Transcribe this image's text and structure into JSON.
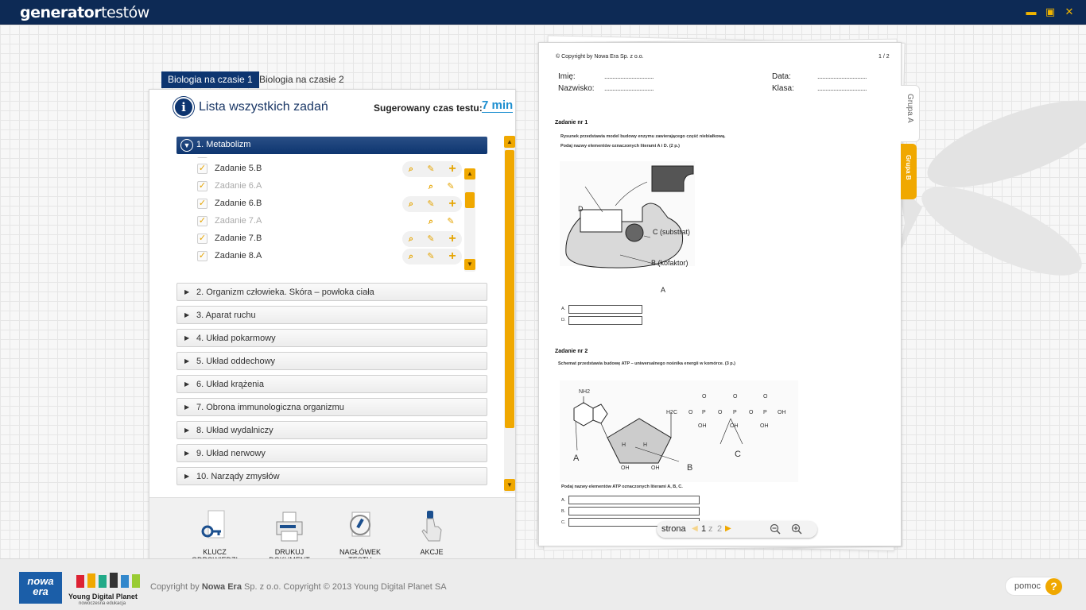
{
  "app": {
    "logo_bold": "generator",
    "logo_light": "testów"
  },
  "window": {
    "minimize": "▬",
    "maximize": "▣",
    "close": "✕"
  },
  "tabs": [
    {
      "label": "Biologia na czasie 1"
    },
    {
      "label": "Biologia na czasie 2"
    }
  ],
  "panel": {
    "info_icon": "i",
    "title": "Lista wszystkich zadań",
    "time_label": "Sugerowany czas testu:",
    "time_value": "7 min"
  },
  "open_category": {
    "label": "1. Metabolizm"
  },
  "tasks": [
    {
      "name": "Zadanie 5.B",
      "dim": false
    },
    {
      "name": "Zadanie 6.A",
      "dim": true
    },
    {
      "name": "Zadanie 6.B",
      "dim": false
    },
    {
      "name": "Zadanie 7.A",
      "dim": true
    },
    {
      "name": "Zadanie 7.B",
      "dim": false
    },
    {
      "name": "Zadanie 8.A",
      "dim": false
    }
  ],
  "categories": [
    "2. Organizm człowieka. Skóra – powłoka ciała",
    "3. Aparat ruchu",
    "4. Układ pokarmowy",
    "5. Układ oddechowy",
    "6. Układ krążenia",
    "7. Obrona immunologiczna organizmu",
    "8. Układ wydalniczy",
    "9. Układ nerwowy",
    "10. Narządy zmysłów"
  ],
  "toolbar": {
    "key": "KLUCZ\nODPOWIEDZI",
    "print": "DRUKUJ\nDOKUMENT",
    "header": "NAGŁÓWEK\nTESTU",
    "actions": "AKCJE"
  },
  "document": {
    "copyright": "© Copyright by Nowa Era Sp. z o.o.",
    "page_of": "1 / 2",
    "imie": "Imię:",
    "nazwisko": "Nazwisko:",
    "data": "Data:",
    "klasa": "Klasa:",
    "dots": "...............................",
    "task1_title": "Zadanie nr 1",
    "task1_text1": "Rysunek przedstawia model budowy enzymu zawierającego część niebiałkową.",
    "task1_text2": "Podaj nazwy elementów oznaczonych literami A i D. (2 p.)",
    "task1_labels": {
      "D": "D",
      "C": "C (substrat)",
      "B": "B (kofaktor)",
      "A": "A"
    },
    "task1_ans": [
      "A.",
      "D."
    ],
    "task2_title": "Zadanie nr 2",
    "task2_text1": "Schemat przedstawia budowę ATP – uniwersalnego nośnika energii w komórce. (3 p.)",
    "task2_text2": "Podaj nazwy elementów ATP oznaczonych literami A, B, C.",
    "task2_ans": [
      "A.",
      "B.",
      "C."
    ],
    "task2_labels": {
      "nh2": "NH2",
      "A": "A",
      "B": "B",
      "C": "C",
      "h2c": "H2C",
      "o": "O",
      "p": "P",
      "oh": "OH",
      "h": "H"
    }
  },
  "pager": {
    "label": "strona",
    "current": "1",
    "sep": "z",
    "total": "2"
  },
  "side_tabs": {
    "a": "Grupa A",
    "b": "Grupa B"
  },
  "footer": {
    "nowa": "nowa",
    "era": "era",
    "ydp_name": "Young Digital Planet",
    "ydp_sub": "nowoczesna edukacja",
    "copy1": "Copyright by ",
    "copy_bold": "Nowa Era",
    "copy2": " Sp. z o.o. Copyright © 2013 Young Digital Planet SA",
    "help": "pomoc",
    "help_icon": "?"
  }
}
